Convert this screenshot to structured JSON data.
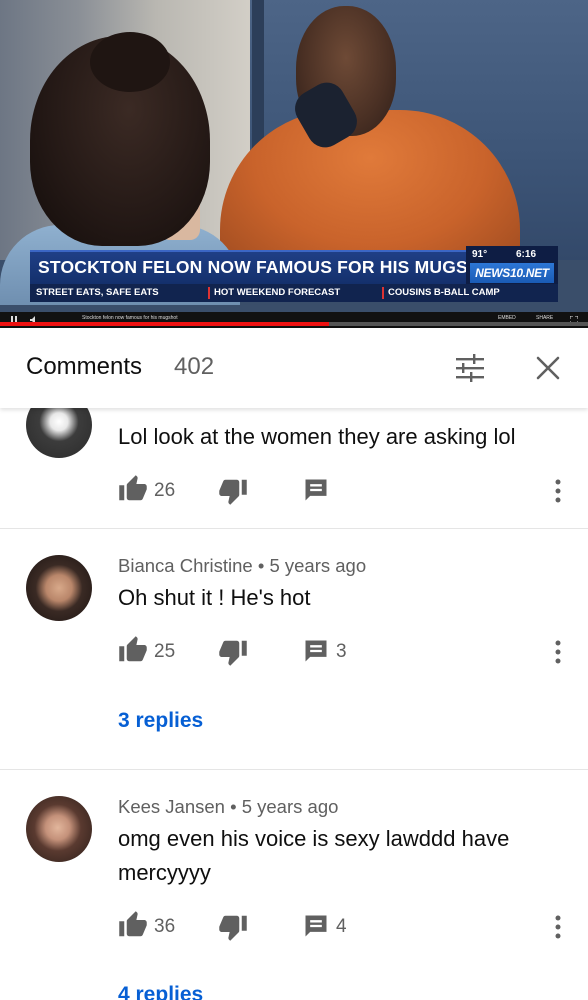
{
  "video": {
    "headline": "STOCKTON FELON NOW FAMOUS FOR HIS MUGSHOT",
    "temperature": "91°",
    "clock": "6:16",
    "station_logo": "NEWS10.NET",
    "ticker": [
      "STREET EATS, SAFE EATS",
      "HOT WEEKEND FORECAST",
      "COUSINS B-BALL CAMP"
    ],
    "player_caption": "Stockton felon now famous for his mugshot",
    "player_labels": [
      "EMBED",
      "SHARE"
    ],
    "progress": 0.56
  },
  "comments_panel": {
    "title": "Comments",
    "count": "402",
    "sort_icon": "sort-filter-icon",
    "close_icon": "close-icon"
  },
  "comments": [
    {
      "author_line": "",
      "text": "Lol look at the women they are asking lol",
      "likes": "26",
      "reply_count": "",
      "replies_link": ""
    },
    {
      "author_line": "Bianca Christine • 5 years ago",
      "text": "Oh shut it ! He's hot",
      "likes": "25",
      "reply_count": "3",
      "replies_link": "3 replies"
    },
    {
      "author_line": "Kees Jansen • 5 years ago",
      "text": "omg even his voice is sexy lawddd have mercyyyy",
      "likes": "36",
      "reply_count": "4",
      "replies_link": "4 replies"
    }
  ],
  "colors": {
    "accent_link": "#065fd4",
    "text_primary": "#0f0f0f",
    "text_secondary": "#606060",
    "progress": "#e11"
  }
}
